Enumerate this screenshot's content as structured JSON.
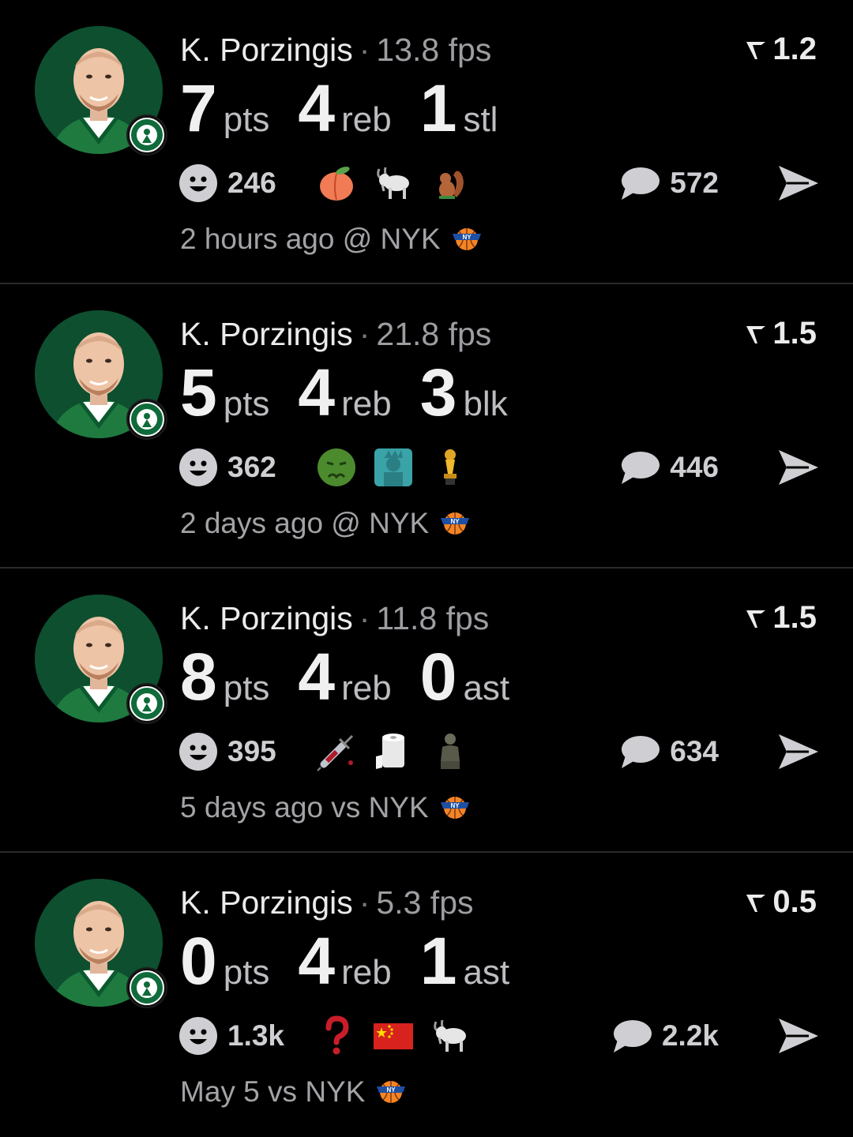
{
  "separator": "·",
  "fps_unit": "fps",
  "colors": {
    "background": "#000000",
    "divider": "#2a2a2c",
    "celtics_green": "#0d4f2f",
    "knicks_orange": "#f58426",
    "knicks_blue": "#1d4fa3"
  },
  "posts": [
    {
      "player": "K. Porzingis",
      "fps": "13.8 fps",
      "score": "1.2",
      "stats": [
        {
          "num": "7",
          "unit": "pts"
        },
        {
          "num": "4",
          "unit": "reb"
        },
        {
          "num": "1",
          "unit": "stl"
        }
      ],
      "reaction_count": "246",
      "emojis": [
        "peach-icon",
        "goat-icon",
        "squirrel-icon"
      ],
      "comments": "572",
      "meta": "2 hours ago @ NYK",
      "opponent_logo": "knicks-logo-icon"
    },
    {
      "player": "K. Porzingis",
      "fps": "21.8 fps",
      "score": "1.5",
      "stats": [
        {
          "num": "5",
          "unit": "pts"
        },
        {
          "num": "4",
          "unit": "reb"
        },
        {
          "num": "3",
          "unit": "blk"
        }
      ],
      "reaction_count": "362",
      "emojis": [
        "nauseated-face-icon",
        "statue-of-liberty-icon",
        "trophy-icon"
      ],
      "comments": "446",
      "meta": "2 days ago @ NYK",
      "opponent_logo": "knicks-logo-icon"
    },
    {
      "player": "K. Porzingis",
      "fps": "11.8 fps",
      "score": "1.5",
      "stats": [
        {
          "num": "8",
          "unit": "pts"
        },
        {
          "num": "4",
          "unit": "reb"
        },
        {
          "num": "0",
          "unit": "ast"
        }
      ],
      "reaction_count": "395",
      "emojis": [
        "syringe-icon",
        "toilet-paper-icon",
        "sitting-figure-icon"
      ],
      "comments": "634",
      "meta": "5 days ago vs NYK",
      "opponent_logo": "knicks-logo-icon"
    },
    {
      "player": "K. Porzingis",
      "fps": "5.3 fps",
      "score": "0.5",
      "stats": [
        {
          "num": "0",
          "unit": "pts"
        },
        {
          "num": "4",
          "unit": "reb"
        },
        {
          "num": "1",
          "unit": "ast"
        }
      ],
      "reaction_count": "1.3k",
      "emojis": [
        "question-mark-icon",
        "china-flag-icon",
        "goat-icon"
      ],
      "comments": "2.2k",
      "meta": "May 5 vs NYK",
      "opponent_logo": "knicks-logo-icon"
    }
  ]
}
